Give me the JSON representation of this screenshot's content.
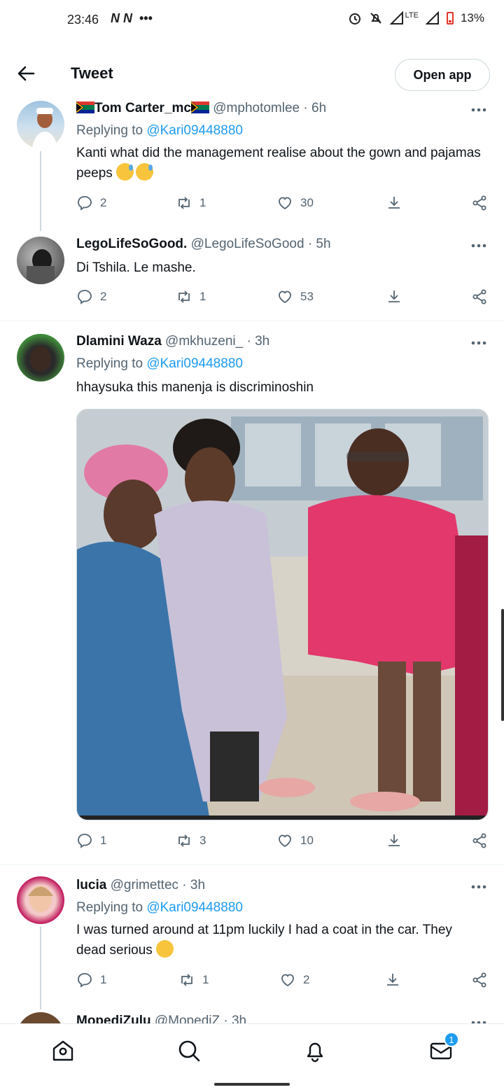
{
  "status_bar": {
    "time": "23:46",
    "left_icons": "N N",
    "network": "LTE",
    "battery": "13%"
  },
  "header": {
    "title": "Tweet",
    "open_app_label": "Open app"
  },
  "tweets": [
    {
      "name": "Tom Carter_mc",
      "handle": "@mphotomlee",
      "time": "· 6h",
      "replying_prefix": "Replying to ",
      "replying_to": "@Kari09448880",
      "text": "Kanti what did the management realise about the gown and pajamas peeps",
      "replies": "2",
      "retweets": "1",
      "likes": "30"
    },
    {
      "name": "LegoLifeSoGood.",
      "handle": "@LegoLifeSoGood",
      "time": "· 5h",
      "text": "Di Tshila. Le mashe.",
      "replies": "2",
      "retweets": "1",
      "likes": "53"
    },
    {
      "name": "Dlamini Waza",
      "handle": "@mkhuzeni_",
      "time": "· 3h",
      "replying_prefix": "Replying to ",
      "replying_to": "@Kari09448880",
      "text": "hhaysuka this manenja is discriminoshin",
      "replies": "1",
      "retweets": "3",
      "likes": "10"
    },
    {
      "name": "lucia",
      "handle": "@grimettec",
      "time": "· 3h",
      "replying_prefix": "Replying to ",
      "replying_to": "@Kari09448880",
      "text": "I was turned around at 11pm luckily I had a coat in the car. They dead serious",
      "replies": "1",
      "retweets": "1",
      "likes": "2"
    },
    {
      "name": "MopediZulu",
      "handle": "@MopediZ",
      "time": "· 3h"
    }
  ],
  "bottom_nav": {
    "messages_badge": "1"
  },
  "colors": {
    "accent": "#1d9bf0",
    "text": "#0f1419",
    "muted": "#536471",
    "border": "#eff3f4"
  }
}
